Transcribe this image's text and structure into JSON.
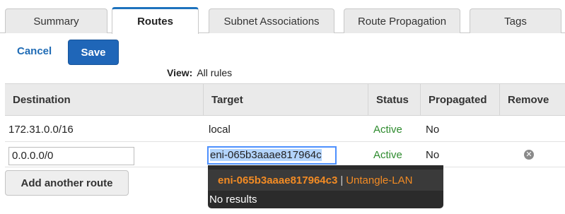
{
  "tabs": [
    {
      "label": "Summary"
    },
    {
      "label": "Routes"
    },
    {
      "label": "Subnet Associations"
    },
    {
      "label": "Route Propagation"
    },
    {
      "label": "Tags"
    }
  ],
  "actions": {
    "cancel_label": "Cancel",
    "save_label": "Save",
    "add_route_label": "Add another route"
  },
  "view": {
    "label": "View:",
    "value": "All rules"
  },
  "table": {
    "headers": [
      "Destination",
      "Target",
      "Status",
      "Propagated",
      "Remove"
    ],
    "rows": [
      {
        "destination": "172.31.0.0/16",
        "target": "local",
        "status": "Active",
        "propagated": "No"
      },
      {
        "destination": "0.0.0.0/0",
        "target": "eni-065b3aaae817964c",
        "status": "Active",
        "propagated": "No"
      }
    ]
  },
  "dropdown": {
    "suggestion_id": "eni-065b3aaae817964c3",
    "suggestion_sep": "|",
    "suggestion_name": "Untangle-LAN",
    "no_results": "No results"
  },
  "colors": {
    "accent": "#1f66b8",
    "status_active": "#2e8b2e",
    "dropdown_highlight": "#f28b24"
  }
}
